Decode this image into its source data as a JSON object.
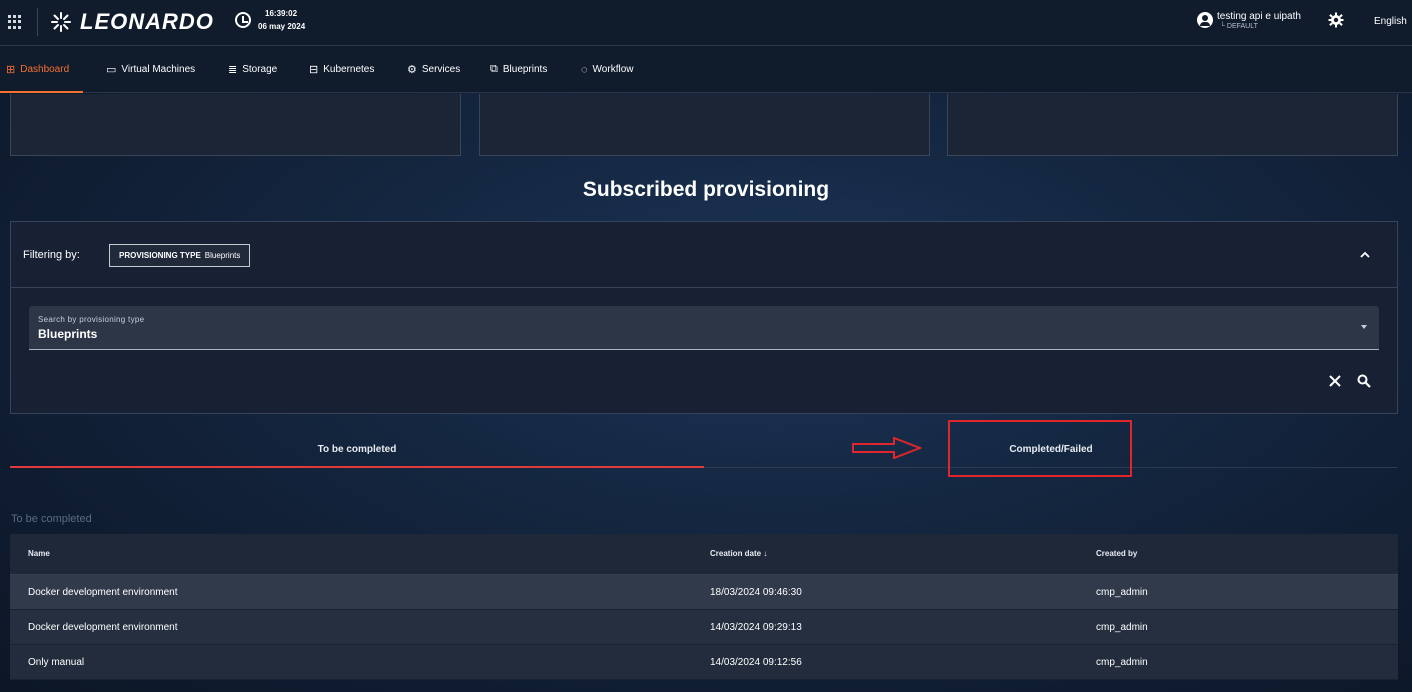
{
  "header": {
    "brand": "LEONARDO",
    "time": "16:39:02",
    "date": "06 may 2024",
    "user_name": "testing api e uipath",
    "user_tenant": "└ DEFAULT",
    "language": "English"
  },
  "nav": {
    "items": [
      {
        "label": "Dashboard",
        "icon": "dashboard-icon"
      },
      {
        "label": "Virtual Machines",
        "icon": "monitor-icon"
      },
      {
        "label": "Storage",
        "icon": "database-icon"
      },
      {
        "label": "Kubernetes",
        "icon": "kubernetes-icon"
      },
      {
        "label": "Services",
        "icon": "services-icon"
      },
      {
        "label": "Blueprints",
        "icon": "blueprints-icon"
      },
      {
        "label": "Workflow",
        "icon": "workflow-icon"
      }
    ],
    "active": "Dashboard",
    "accent": "#f3702f"
  },
  "main": {
    "title": "Subscribed provisioning",
    "filter": {
      "label": "Filtering by:",
      "chip_key": "PROVISIONING TYPE",
      "chip_value": "Blueprints",
      "select_label": "Search by provisioning type",
      "select_value": "Blueprints"
    },
    "tabs": [
      {
        "label": "To be completed",
        "selected": true
      },
      {
        "label": "Completed/Failed",
        "selected": false
      }
    ],
    "section_label": "To be completed",
    "table": {
      "headers": {
        "name": "Name",
        "creation_date": "Creation date ↓",
        "created_by": "Created by"
      },
      "rows": [
        {
          "name": "Docker development environment",
          "creation_date": "18/03/2024 09:46:30",
          "created_by": "cmp_admin"
        },
        {
          "name": "Docker development environment",
          "creation_date": "14/03/2024 09:29:13",
          "created_by": "cmp_admin"
        },
        {
          "name": "Only manual",
          "creation_date": "14/03/2024 09:12:56",
          "created_by": "cmp_admin"
        }
      ]
    }
  },
  "colors": {
    "annotation_red": "#e0262b",
    "tab_indicator": "#e03a3a"
  }
}
